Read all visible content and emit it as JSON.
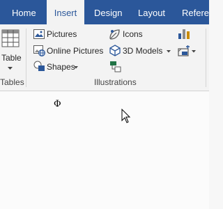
{
  "tabs": [
    {
      "label": "Home",
      "active": false
    },
    {
      "label": "Insert",
      "active": true
    },
    {
      "label": "Design",
      "active": false
    },
    {
      "label": "Layout",
      "active": false
    },
    {
      "label": "Referen",
      "active": false
    }
  ],
  "ribbon": {
    "tables_group": {
      "table_button": "Table",
      "group_label": "Tables"
    },
    "illustrations_group": {
      "pictures": "Pictures",
      "online_pictures": "Online Pictures",
      "shapes": "Shapes",
      "icons": "Icons",
      "models_3d": "3D Models",
      "group_label": "Illustrations"
    }
  },
  "document": {
    "symbol": "Φ"
  },
  "colors": {
    "tab_bar": "#2b579a",
    "ribbon_bg": "#f3f3f3",
    "accent": "#2b579a",
    "green": "#217346"
  },
  "icons": [
    "table-icon",
    "pictures-icon",
    "online-pictures-icon",
    "shapes-icon",
    "icons-icon",
    "3d-models-icon",
    "smartart-icon",
    "chart-icon",
    "screenshot-icon",
    "mouse-cursor-icon"
  ]
}
